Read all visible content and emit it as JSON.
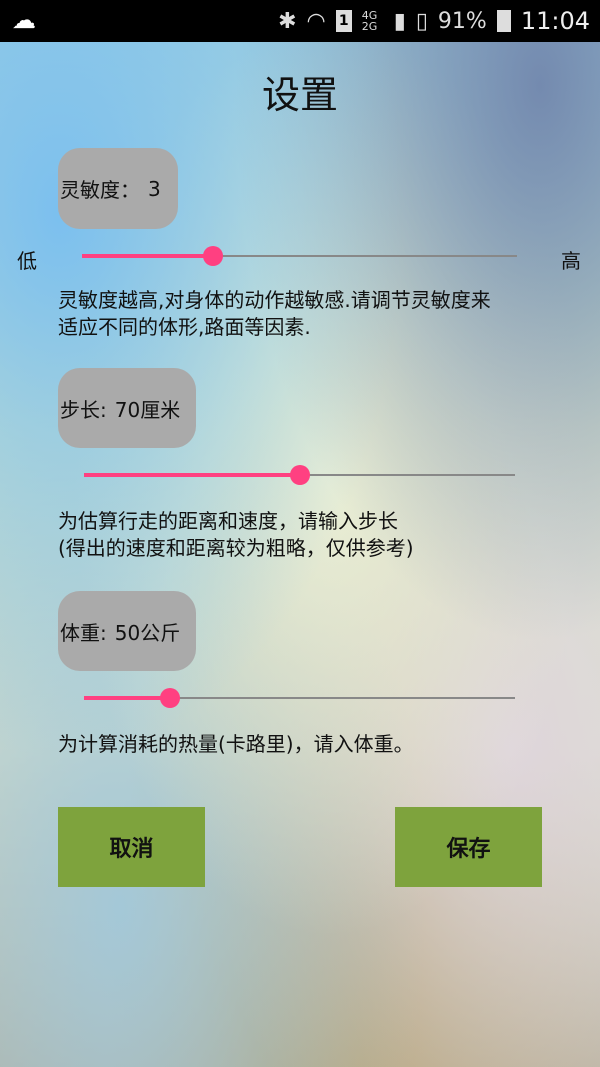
{
  "status_bar": {
    "battery": "91%",
    "time": "11:04",
    "network": "4G 2G",
    "sim": "1",
    "icons": [
      "weather-icon",
      "bluetooth-icon",
      "wifi-icon",
      "sim-icon",
      "signal-icon",
      "sd-card-icon",
      "battery-charging-icon"
    ]
  },
  "title": "设置",
  "sensitivity": {
    "label": "灵敏度：",
    "value": "3",
    "low_label": "低",
    "high_label": "高",
    "level": 0.3,
    "desc_line1": "灵敏度越高,对身体的动作越敏感.请调节灵敏度来",
    "desc_line2": "适应不同的体形,路面等因素."
  },
  "step": {
    "label": "步长:",
    "value": "70厘米",
    "level": 0.5,
    "desc_line1": "为估算行走的距离和速度，请输入步长",
    "desc_line2": "(得出的速度和距离较为粗略，仅供参考)"
  },
  "weight": {
    "label": "体重:",
    "value": "50公斤",
    "level": 0.2,
    "desc_line1": "为计算消耗的热量(卡路里)，请入体重。"
  },
  "buttons": {
    "cancel": "取消",
    "save": "保存"
  },
  "colors": {
    "accent": "#ff4081",
    "button": "#7ea33d",
    "chip": "#aaaaaa"
  }
}
